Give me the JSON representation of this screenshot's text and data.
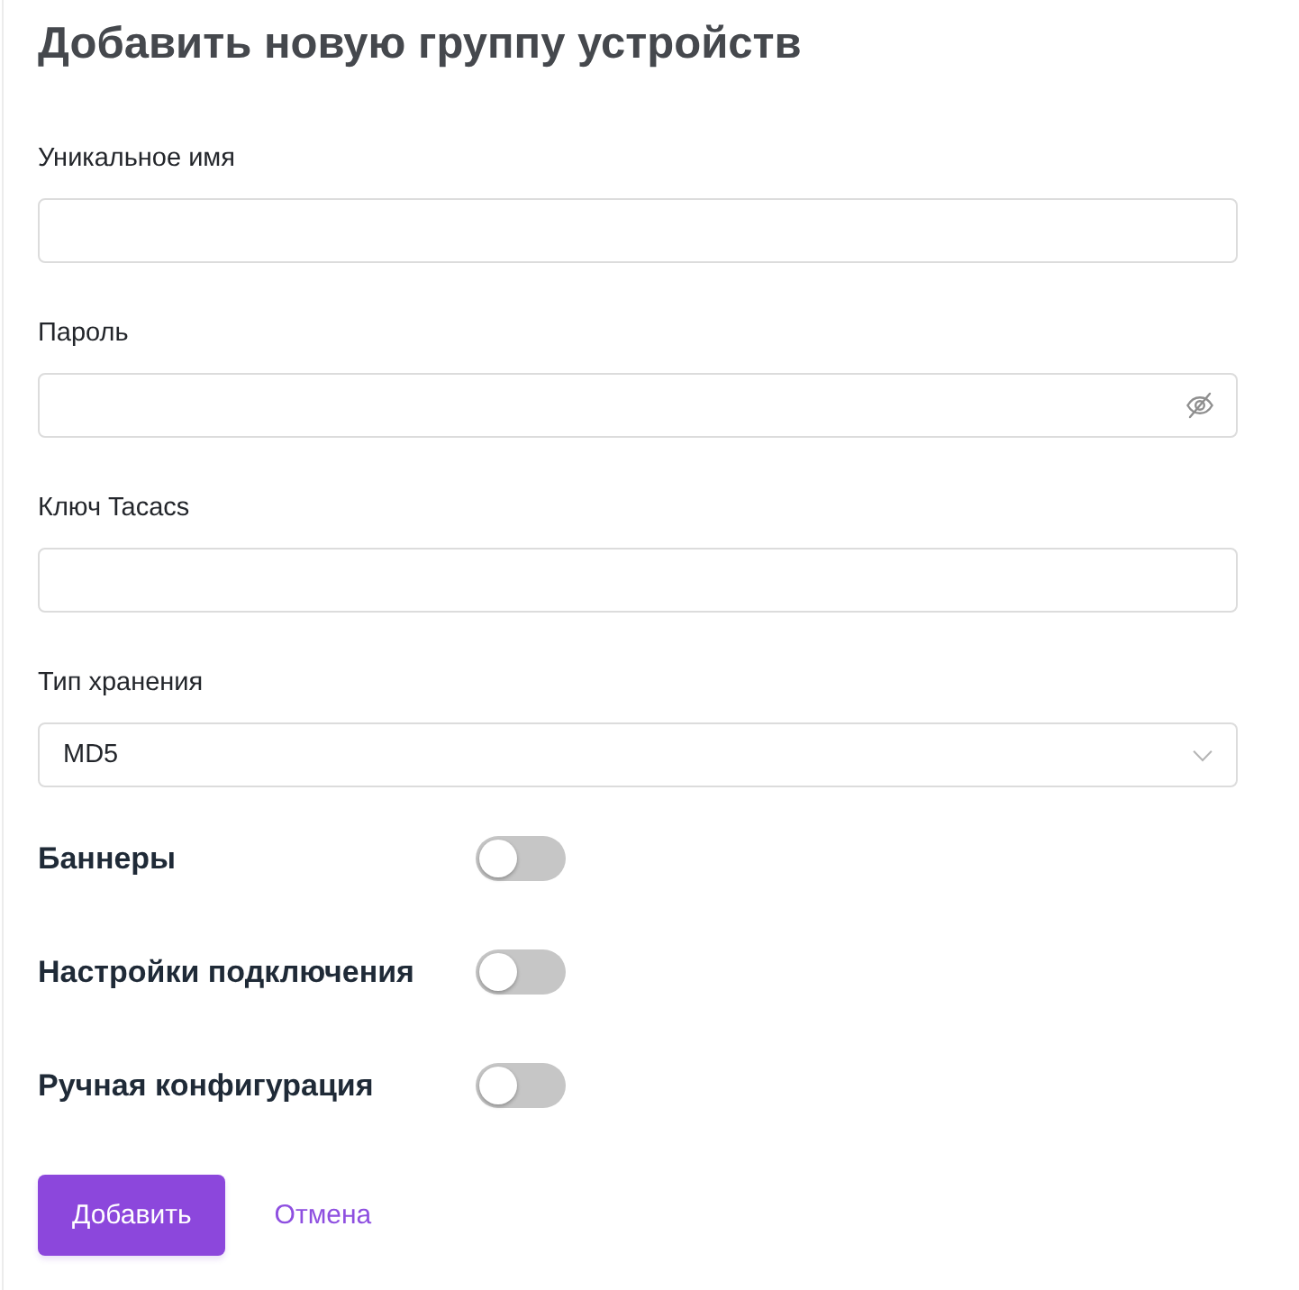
{
  "title": "Добавить новую группу устройств",
  "fields": [
    {
      "kind": "text",
      "label": "Уникальное имя"
    },
    {
      "kind": "password",
      "label": "Пароль"
    },
    {
      "kind": "text",
      "label": "Ключ Tacacs"
    },
    {
      "kind": "select",
      "label": "Тип хранения",
      "value": "MD5"
    }
  ],
  "toggles": [
    {
      "label": "Баннеры",
      "on": false
    },
    {
      "label": "Настройки подключения",
      "on": false
    },
    {
      "label": "Ручная конфигурация",
      "on": false
    }
  ],
  "actions": {
    "submit": "Добавить",
    "cancel": "Отмена"
  }
}
